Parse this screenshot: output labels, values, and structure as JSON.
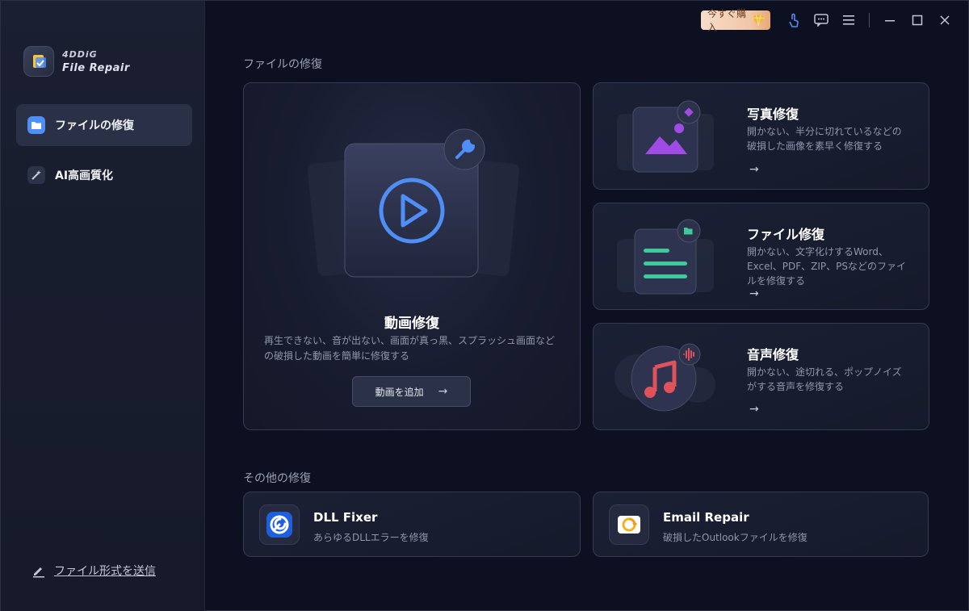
{
  "app": {
    "logo_line1": "4DDiG",
    "logo_line2": "File Repair"
  },
  "sidebar": {
    "items": [
      {
        "label": "ファイルの修復",
        "active": true
      },
      {
        "label": "AI高画質化",
        "active": false
      }
    ],
    "footer_link": "ファイル形式を送信"
  },
  "titlebar": {
    "buy_label": "今すぐ購入"
  },
  "main": {
    "section1_title": "ファイルの修復",
    "video": {
      "title": "動画修復",
      "description": "再生できない、音が出ない、画面が真っ黒、スプラッシュ画面などの破損した動画を簡単に修復する",
      "button_label": "動画を追加",
      "button_arrow": "→"
    },
    "photo": {
      "title": "写真修復",
      "description": "開かない、半分に切れているなどの破損した画像を素早く修復する",
      "arrow": "→"
    },
    "file": {
      "title": "ファイル修復",
      "description": "開かない、文字化けするWord、Excel、PDF、ZIP、PSなどのファイルを修復する",
      "arrow": "→"
    },
    "audio": {
      "title": "音声修復",
      "description": "開かない、途切れる、ポップノイズがする音声を修復する",
      "arrow": "→"
    },
    "section2_title": "その他の修復",
    "dll": {
      "title": "DLL Fixer",
      "description": "あらゆるDLLエラーを修復"
    },
    "email": {
      "title": "Email Repair",
      "description": "破損したOutlookファイルを修復"
    }
  },
  "colors": {
    "accent_blue": "#4f8ef7",
    "photo_purple": "#a04be6",
    "file_green": "#3fc89a",
    "audio_red": "#e0525a",
    "buy_orange": "#f2c7a8"
  }
}
